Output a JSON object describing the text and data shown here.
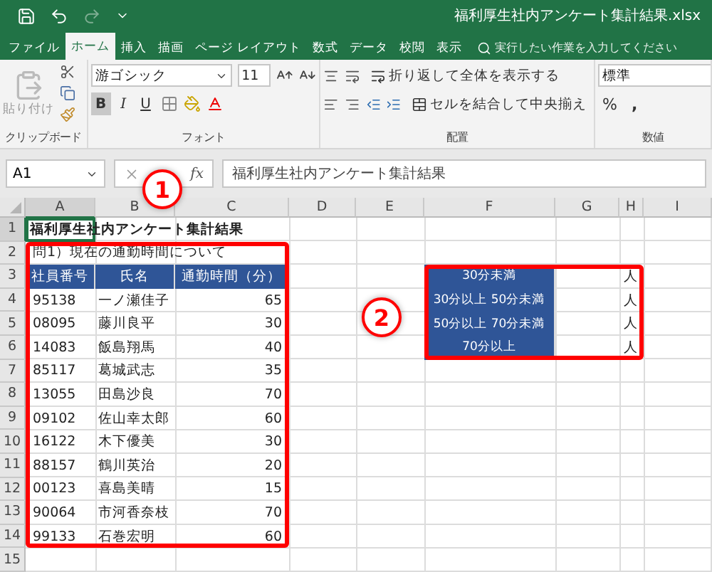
{
  "title_bar": {
    "filename": "福利厚生社内アンケート集計結果.xlsx"
  },
  "tabs": [
    {
      "label": "ファイル",
      "selected": false
    },
    {
      "label": "ホーム",
      "selected": true
    },
    {
      "label": "挿入",
      "selected": false
    },
    {
      "label": "描画",
      "selected": false
    },
    {
      "label": "ページ レイアウト",
      "selected": false
    },
    {
      "label": "数式",
      "selected": false
    },
    {
      "label": "データ",
      "selected": false
    },
    {
      "label": "校閲",
      "selected": false
    },
    {
      "label": "表示",
      "selected": false
    }
  ],
  "tell_me": {
    "placeholder": "実行したい作業を入力してください"
  },
  "ribbon": {
    "clipboard": {
      "paste": "貼り付け",
      "label": "クリップボード"
    },
    "font": {
      "name": "游ゴシック",
      "size": "11",
      "bold": "B",
      "italic": "I",
      "underline": "U",
      "label": "フォント"
    },
    "alignment": {
      "wrap": "折り返して全体を表示する",
      "merge": "セルを結合して中央揃え",
      "label": "配置"
    },
    "number": {
      "format": "標準",
      "percent": "%",
      "comma": ",",
      "label": "数値"
    }
  },
  "formula_bar": {
    "name_box": "A1",
    "function": "fx",
    "content": "福利厚生社内アンケート集計結果"
  },
  "columns": [
    "A",
    "B",
    "C",
    "D",
    "E",
    "F",
    "G",
    "H",
    "I"
  ],
  "row_numbers": [
    "1",
    "2",
    "3",
    "4",
    "5",
    "6",
    "7",
    "8",
    "9",
    "10",
    "11",
    "12",
    "13",
    "14",
    "15"
  ],
  "survey": {
    "title": {
      "text": "福利厚生社内アンケート集計結果",
      "selected": true
    },
    "question": "問1）現在の通勤時間について",
    "headers": [
      "社員番号",
      "氏名",
      "通勤時間（分）"
    ],
    "rows": [
      [
        "95138",
        "一ノ瀬佳子",
        "65"
      ],
      [
        "08095",
        "藤川良平",
        "30"
      ],
      [
        "14083",
        "飯島翔馬",
        "40"
      ],
      [
        "85117",
        "葛城武志",
        "35"
      ],
      [
        "13055",
        "田島沙良",
        "70"
      ],
      [
        "09102",
        "佐山幸太郎",
        "60"
      ],
      [
        "16122",
        "木下優美",
        "30"
      ],
      [
        "88157",
        "鶴川英治",
        "20"
      ],
      [
        "00123",
        "喜島美晴",
        "15"
      ],
      [
        "90064",
        "市河香奈枝",
        "70"
      ],
      [
        "99133",
        "石巻宏明",
        "60"
      ]
    ]
  },
  "summary": {
    "rows": [
      {
        "range": "30分未満",
        "unit": "人"
      },
      {
        "range": "30分以上 50分未満",
        "unit": "人"
      },
      {
        "range": "50分以上 70分未満",
        "unit": "人"
      },
      {
        "range": "70分以上",
        "unit": "人"
      }
    ]
  },
  "callouts": [
    {
      "label": "1"
    },
    {
      "label": "2"
    }
  ]
}
